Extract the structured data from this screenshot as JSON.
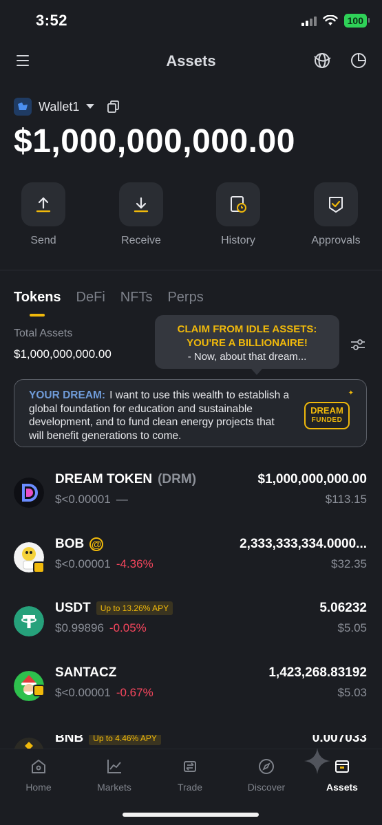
{
  "status": {
    "time": "3:52",
    "battery": "100"
  },
  "header": {
    "title": "Assets"
  },
  "wallet": {
    "name": "Wallet1",
    "balance": "$1,000,000,000.00"
  },
  "actions": [
    {
      "label": "Send",
      "icon": "send-icon"
    },
    {
      "label": "Receive",
      "icon": "receive-icon"
    },
    {
      "label": "History",
      "icon": "history-icon"
    },
    {
      "label": "Approvals",
      "icon": "approvals-icon"
    }
  ],
  "tabs": [
    "Tokens",
    "DeFi",
    "NFTs",
    "Perps"
  ],
  "total": {
    "label": "Total Assets",
    "value": "$1,000,000,000.00"
  },
  "callout": {
    "line1": "CLAIM FROM IDLE ASSETS:",
    "line2": "YOU'RE A BILLIONAIRE!",
    "line3": "- Now, about that dream..."
  },
  "dream": {
    "label": "YOUR DREAM:",
    "text": "I want to use this wealth to establish a global foundation for education and sustainable development, and to fund clean energy projects that will benefit generations to come.",
    "badge_line1": "DREAM",
    "badge_line2": "FUNDED"
  },
  "tokens": [
    {
      "name": "DREAM TOKEN",
      "symbol": "(DRM)",
      "price": "$<0.00001",
      "change": "—",
      "amount": "$1,000,000,000.00",
      "value": "$113.15",
      "apy": ""
    },
    {
      "name": "BOB",
      "badge": "@",
      "price": "$<0.00001",
      "change": "-4.36%",
      "amount": "2,333,333,334.0000...",
      "value": "$32.35",
      "apy": ""
    },
    {
      "name": "USDT",
      "price": "$0.99896",
      "change": "-0.05%",
      "amount": "5.06232",
      "value": "$5.05",
      "apy": "Up to 13.26% APY"
    },
    {
      "name": "SANTACZ",
      "price": "$<0.00001",
      "change": "-0.67%",
      "amount": "1,423,268.83192",
      "value": "$5.03",
      "apy": ""
    },
    {
      "name": "BNB",
      "price": "",
      "change": "",
      "amount": "0.007033",
      "value": "",
      "apy": "Up to 4.46% APY"
    }
  ],
  "nav": [
    "Home",
    "Markets",
    "Trade",
    "Discover",
    "Assets"
  ],
  "colors": {
    "accent": "#f0b90b",
    "negative": "#f6465d",
    "background": "#1b1d22"
  }
}
